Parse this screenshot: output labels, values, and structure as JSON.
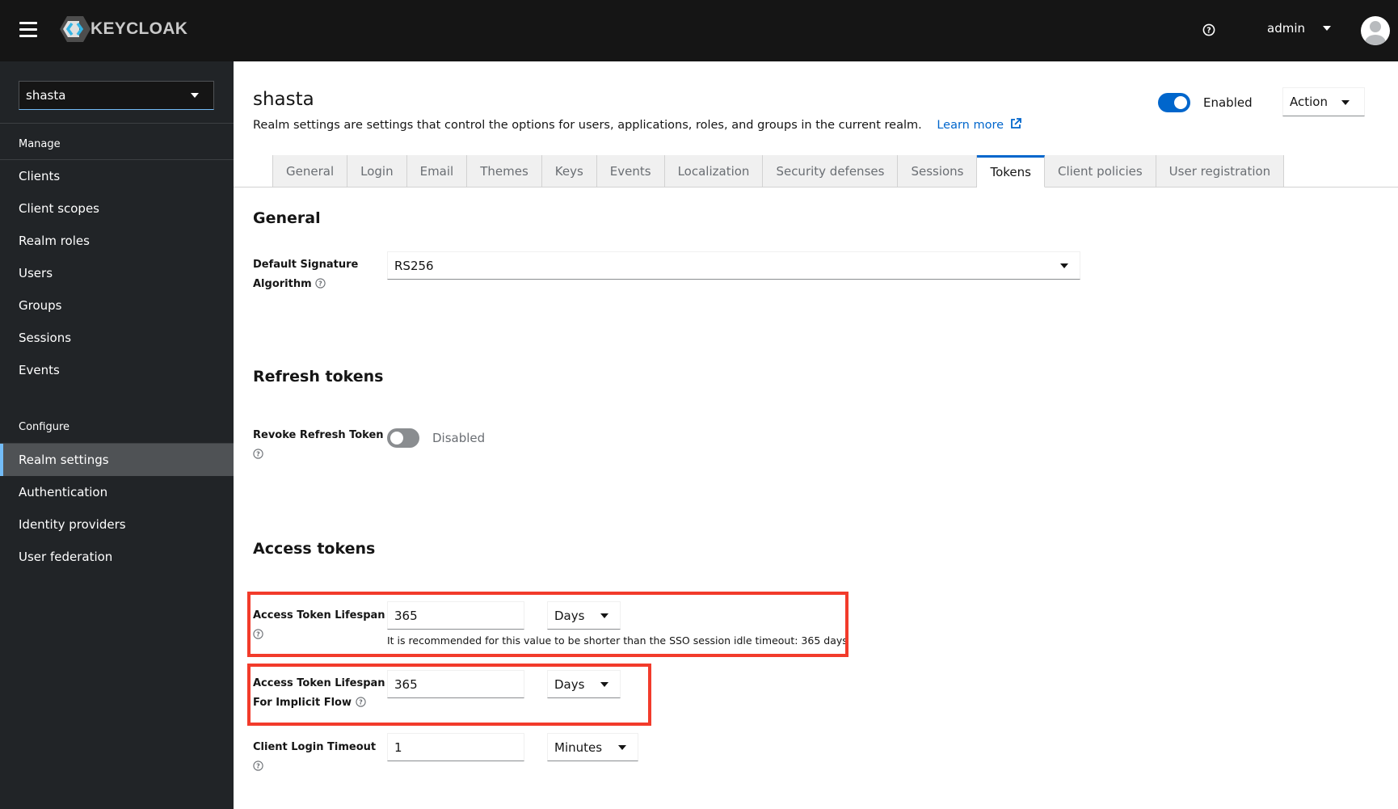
{
  "header": {
    "brand": "KEYCLOAK",
    "user_name": "admin"
  },
  "sidebar": {
    "realm": "shasta",
    "sections": [
      {
        "title": "Manage",
        "items": [
          "Clients",
          "Client scopes",
          "Realm roles",
          "Users",
          "Groups",
          "Sessions",
          "Events"
        ]
      },
      {
        "title": "Configure",
        "items": [
          "Realm settings",
          "Authentication",
          "Identity providers",
          "User federation"
        ]
      }
    ],
    "active_item": "Realm settings"
  },
  "page": {
    "title": "shasta",
    "description": "Realm settings are settings that control the options for users, applications, roles, and groups in the current realm.",
    "learn_more": "Learn more",
    "enabled_label": "Enabled",
    "enabled": true,
    "action_label": "Action"
  },
  "tabs": [
    "General",
    "Login",
    "Email",
    "Themes",
    "Keys",
    "Events",
    "Localization",
    "Security defenses",
    "Sessions",
    "Tokens",
    "Client policies",
    "User registration"
  ],
  "active_tab": "Tokens",
  "general": {
    "title": "General",
    "signature_label_line1": "Default Signature",
    "signature_label_line2": "Algorithm",
    "signature_value": "RS256"
  },
  "refresh": {
    "title": "Refresh tokens",
    "revoke_label": "Revoke Refresh Token",
    "revoke_state": "Disabled",
    "revoke_enabled": false
  },
  "access": {
    "title": "Access tokens",
    "lifespan": {
      "label": "Access Token Lifespan",
      "value": "365",
      "unit": "Days",
      "helper": "It is recommended for this value to be shorter than the SSO session idle timeout: 365 days"
    },
    "implicit": {
      "label_line1": "Access Token Lifespan",
      "label_line2": "For Implicit Flow",
      "value": "365",
      "unit": "Days"
    },
    "client_login": {
      "label": "Client Login Timeout",
      "value": "1",
      "unit": "Minutes"
    }
  },
  "colors": {
    "accent": "#0066cc",
    "highlight_box": "#f23b2b",
    "masthead": "#151515",
    "sidebar": "#212427",
    "sidebar_active": "#4f5255"
  }
}
